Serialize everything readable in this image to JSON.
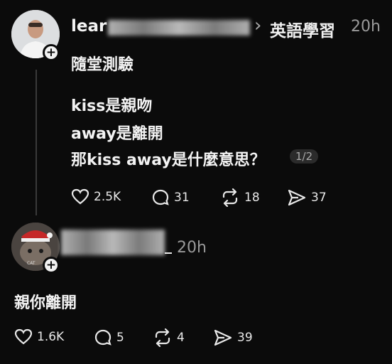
{
  "post": {
    "username": "lear",
    "topic_separator": "›",
    "topic": "英語學習",
    "time": "20h",
    "title": "隨堂測驗",
    "lines": [
      "kiss是親吻",
      "away是離開",
      "那kiss away是什麼意思？"
    ],
    "page_indicator": "1/2",
    "actions": {
      "likes": "2.5K",
      "comments": "31",
      "reposts": "18",
      "shares": "37"
    }
  },
  "reply": {
    "username_suffix": "_",
    "time": "20h",
    "avatar_text": "CAT",
    "text": "親你離開",
    "actions": {
      "likes": "1.6K",
      "comments": "5",
      "reposts": "4",
      "shares": "39"
    }
  },
  "icons": {
    "follow": "plus-icon",
    "like": "heart-icon",
    "comment": "comment-bubble-icon",
    "repost": "repost-arrows-icon",
    "share": "send-arrow-icon"
  }
}
